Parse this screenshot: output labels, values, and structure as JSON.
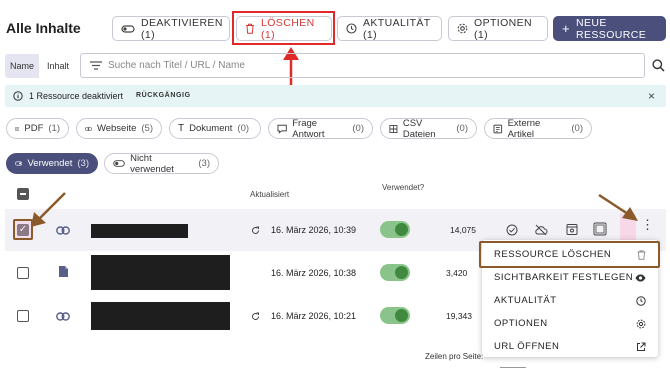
{
  "page_title": "Alle Inhalte",
  "toolbar": {
    "deactivate": "DEAKTIVIEREN (1)",
    "delete": "LÖSCHEN (1)",
    "actuality": "AKTUALITÄT (1)",
    "options": "OPTIONEN (1)",
    "new_resource": "NEUE RESSOURCE"
  },
  "search": {
    "tab_name": "Name",
    "tab_content": "Inhalt",
    "placeholder": "Suche nach Titel / URL / Name"
  },
  "info_banner": {
    "text": "1 Ressource deaktiviert",
    "undo": "RÜCKGÄNGIG"
  },
  "filters": [
    {
      "label": "PDF",
      "count": "(1)"
    },
    {
      "label": "Webseite",
      "count": "(5)"
    },
    {
      "label": "Dokument",
      "count": "(0)"
    },
    {
      "label": "Frage Antwort",
      "count": "(0)"
    },
    {
      "label": "CSV Dateien",
      "count": "(0)"
    },
    {
      "label": "Externe Artikel",
      "count": "(0)"
    }
  ],
  "usage_filters": {
    "used": "Verwendet",
    "used_count": "(3)",
    "unused": "Nicht verwendet",
    "unused_count": "(3)"
  },
  "table": {
    "col_updated": "Aktualisiert",
    "col_used": "Verwendet?",
    "rows": [
      {
        "date": "16. März 2026, 10:39",
        "count": "14,075",
        "type": "link",
        "checked": true
      },
      {
        "date": "16. März 2026, 10:38",
        "count": "3,420",
        "type": "file",
        "checked": false
      },
      {
        "date": "16. März 2026, 10:21",
        "count": "19,343",
        "type": "link",
        "checked": false
      }
    ]
  },
  "context_menu": {
    "items": [
      {
        "label": "RESSOURCE LÖSCHEN",
        "icon": "trash-icon"
      },
      {
        "label": "SICHTBARKEIT FESTLEGEN",
        "icon": "eye-icon"
      },
      {
        "label": "AKTUALITÄT",
        "icon": "clock-icon"
      },
      {
        "label": "OPTIONEN",
        "icon": "gear-icon"
      },
      {
        "label": "URL ÖFFNEN",
        "icon": "external-link-icon"
      }
    ]
  },
  "footer": {
    "rows_per_page": "Zeilen pro Seite:"
  },
  "colors": {
    "primary": "#4a4f7c",
    "annotation_red": "#e02a2a",
    "annotation_brown": "#8b5a2b",
    "banner_bg": "#e6f4f5",
    "toggle_on": "#3f8a3f"
  }
}
